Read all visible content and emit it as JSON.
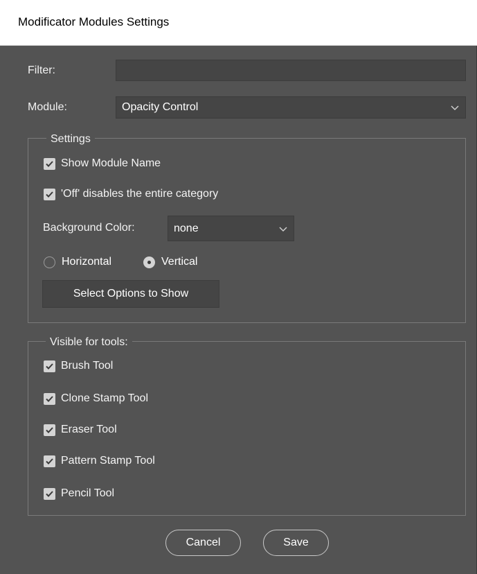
{
  "window": {
    "title": "Modificator Modules Settings"
  },
  "filter": {
    "label": "Filter:",
    "value": ""
  },
  "module": {
    "label": "Module:",
    "selected": "Opacity Control"
  },
  "settings": {
    "legend": "Settings",
    "show_module_name": {
      "label": "Show Module Name",
      "checked": true
    },
    "off_disables": {
      "label": "'Off' disables the entire category",
      "checked": true
    },
    "background_color": {
      "label": "Background Color:",
      "selected": "none"
    },
    "orientation": {
      "horizontal": {
        "label": "Horizontal",
        "selected": false
      },
      "vertical": {
        "label": "Vertical",
        "selected": true
      }
    },
    "select_options_button": "Select Options to Show"
  },
  "tools": {
    "legend": "Visible for tools:",
    "items": [
      {
        "label": "Brush Tool",
        "checked": true
      },
      {
        "label": "Clone Stamp Tool",
        "checked": true
      },
      {
        "label": "Eraser Tool",
        "checked": true
      },
      {
        "label": "Pattern Stamp Tool",
        "checked": true
      },
      {
        "label": "Pencil Tool",
        "checked": true
      }
    ]
  },
  "footer": {
    "cancel": "Cancel",
    "save": "Save"
  },
  "colors": {
    "dialog_bg": "#535353",
    "field_bg": "#454545",
    "checkbox": "#d4d4d4"
  }
}
